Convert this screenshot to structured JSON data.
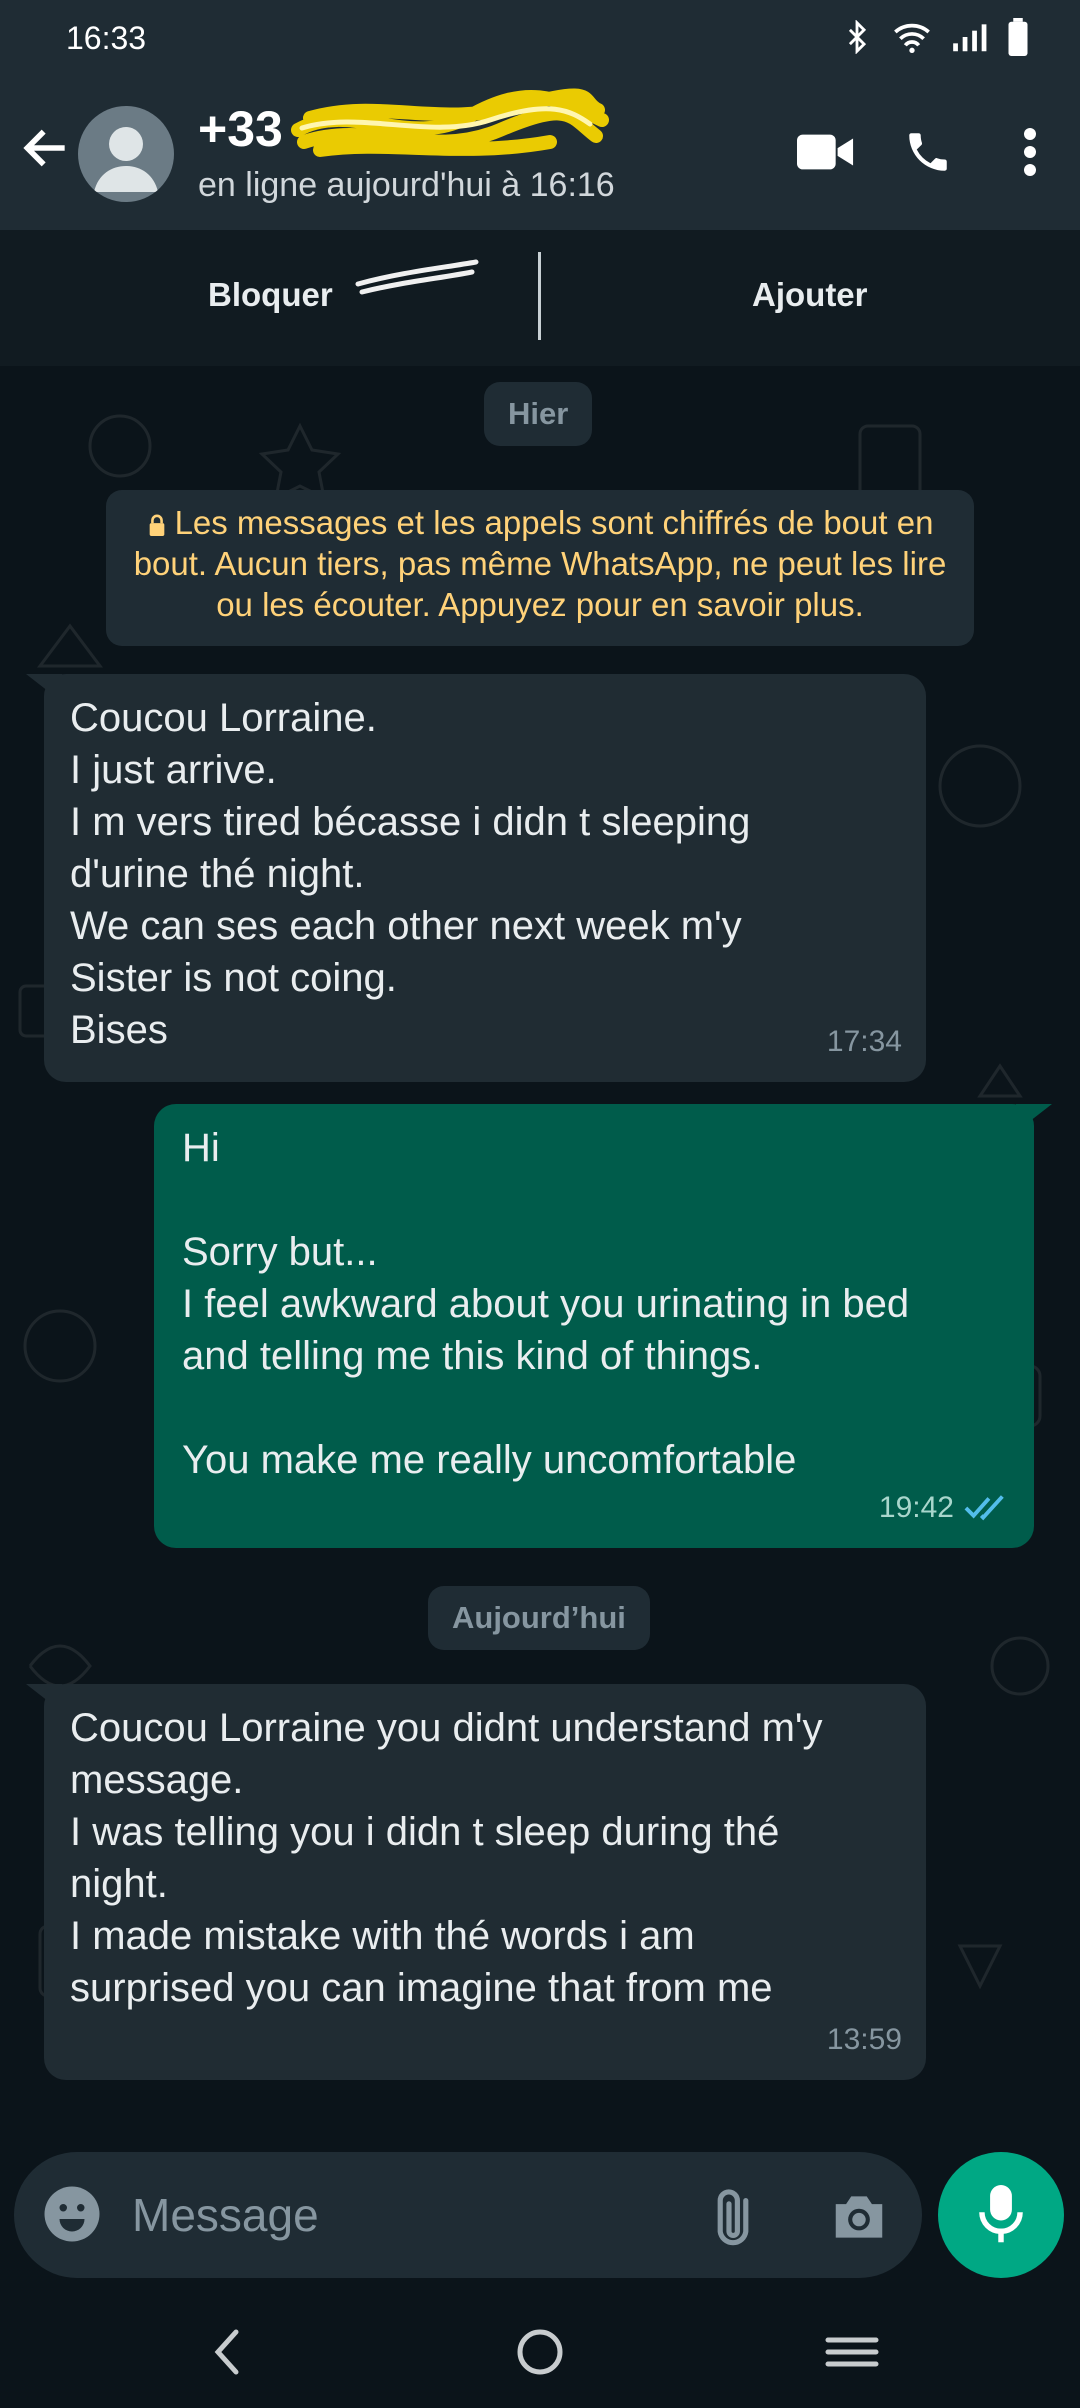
{
  "status_bar": {
    "time": "16:33"
  },
  "header": {
    "contact_prefix": "+33",
    "presence": "en ligne aujourd'hui à 16:16"
  },
  "actions": {
    "block": "Bloquer",
    "add": "Ajouter"
  },
  "chat": {
    "date_yesterday": "Hier",
    "encryption_notice": "Les messages et les appels sont chiffrés de bout en bout. Aucun tiers, pas même WhatsApp, ne peut les lire ou les écouter. Appuyez pour en savoir plus.",
    "messages": [
      {
        "direction": "incoming",
        "text": "Coucou Lorraine.\nI just arrive.\nI m vers tired bécasse i didn t sleeping\nd'urine thé night.\nWe can ses each other next week m'y\nSister is not coing.\nBises",
        "time": "17:34"
      },
      {
        "direction": "outgoing",
        "text": "Hi\n\nSorry but...\nI feel awkward about you urinating in bed\nand telling me this kind of things.\n\nYou make me really uncomfortable",
        "time": "19:42",
        "status": "read"
      },
      {
        "direction": "incoming",
        "text": "Coucou Lorraine you didnt understand m'y\nmessage.\nI was telling you i didn t sleep during thé\nnight.\nI made mistake with thé words i am\nsurprised you can imagine that from me",
        "time": "13:59"
      }
    ],
    "date_today": "Aujourd’hui"
  },
  "composer": {
    "placeholder": "Message"
  },
  "colors": {
    "app_bar": "#1f2c34",
    "incoming_bubble": "#202c33",
    "outgoing_bubble": "#005c4b",
    "accent": "#00a884",
    "read_ticks": "#53bdeb",
    "notice_text": "#ffd279"
  },
  "icons": [
    "back-arrow-icon",
    "video-call-icon",
    "voice-call-icon",
    "more-options-icon",
    "lock-icon",
    "double-check-icon",
    "emoji-icon",
    "attach-icon",
    "camera-icon",
    "mic-icon",
    "nav-back-icon",
    "nav-home-icon",
    "nav-recents-icon"
  ]
}
